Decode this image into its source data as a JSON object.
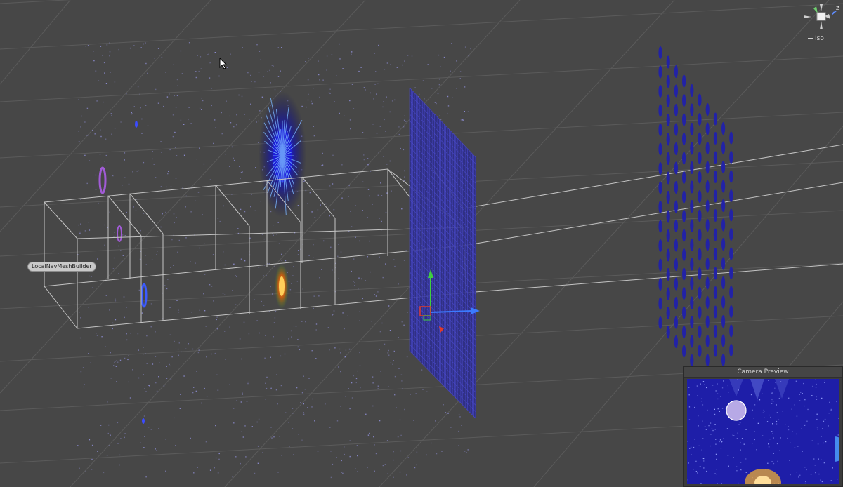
{
  "scene": {
    "object_label": "LocalNavMeshBuilder",
    "projection_label": "Iso",
    "gizmo_axis_label": "z"
  },
  "camera_preview": {
    "title": "Camera Preview"
  },
  "colors": {
    "background": "#474747",
    "grid": "#5a5a5a",
    "wireframe": "#c4c4c4",
    "panel_blue": "#2b2b9a",
    "axis_x": "#3b7bff",
    "axis_y": "#3fcf3f",
    "axis_z": "#e03a2a"
  },
  "icons": [
    "cursor-arrow-icon",
    "scene-orientation-gizmo-icon",
    "menu-lines-icon",
    "move-tool-icon"
  ]
}
